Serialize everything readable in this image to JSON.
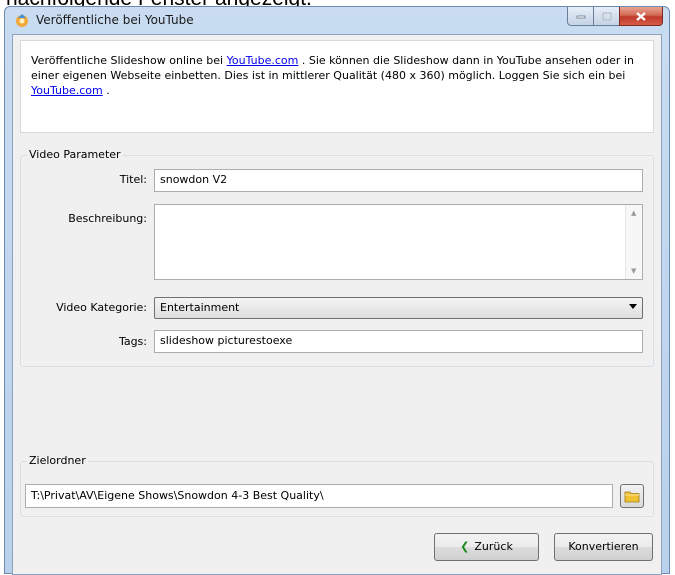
{
  "page_caption": "nachfolgende Fenster angezeigt.",
  "window": {
    "title": "Veröffentliche bei YouTube"
  },
  "intro": {
    "text_1": "Veröffentliche Slideshow online bei ",
    "link_1": "YouTube.com",
    "text_2": " . Sie können die Slideshow dann in YouTube ansehen oder in einer eigenen Webseite einbetten. Dies ist in mittlerer Qualität (480 x 360) möglich. Loggen Sie sich ein bei ",
    "link_2": "YouTube.com",
    "text_3": " ."
  },
  "video_params": {
    "group_label": "Video Parameter",
    "title_label": "Titel:",
    "title_value": "snowdon V2",
    "description_label": "Beschreibung:",
    "description_value": "",
    "category_label": "Video Kategorie:",
    "category_value": "Entertainment",
    "tags_label": "Tags:",
    "tags_value": "slideshow picturestoexe"
  },
  "target": {
    "group_label": "Zielordner",
    "path_value": "T:\\Privat\\AV\\Eigene Shows\\Snowdon 4-3 Best Quality\\"
  },
  "buttons": {
    "back": "Zurück",
    "convert": "Konvertieren"
  },
  "icons": {
    "app": "picturestoexe-icon",
    "folder": "folder-icon",
    "back_arrow": "chevron-left-icon"
  }
}
